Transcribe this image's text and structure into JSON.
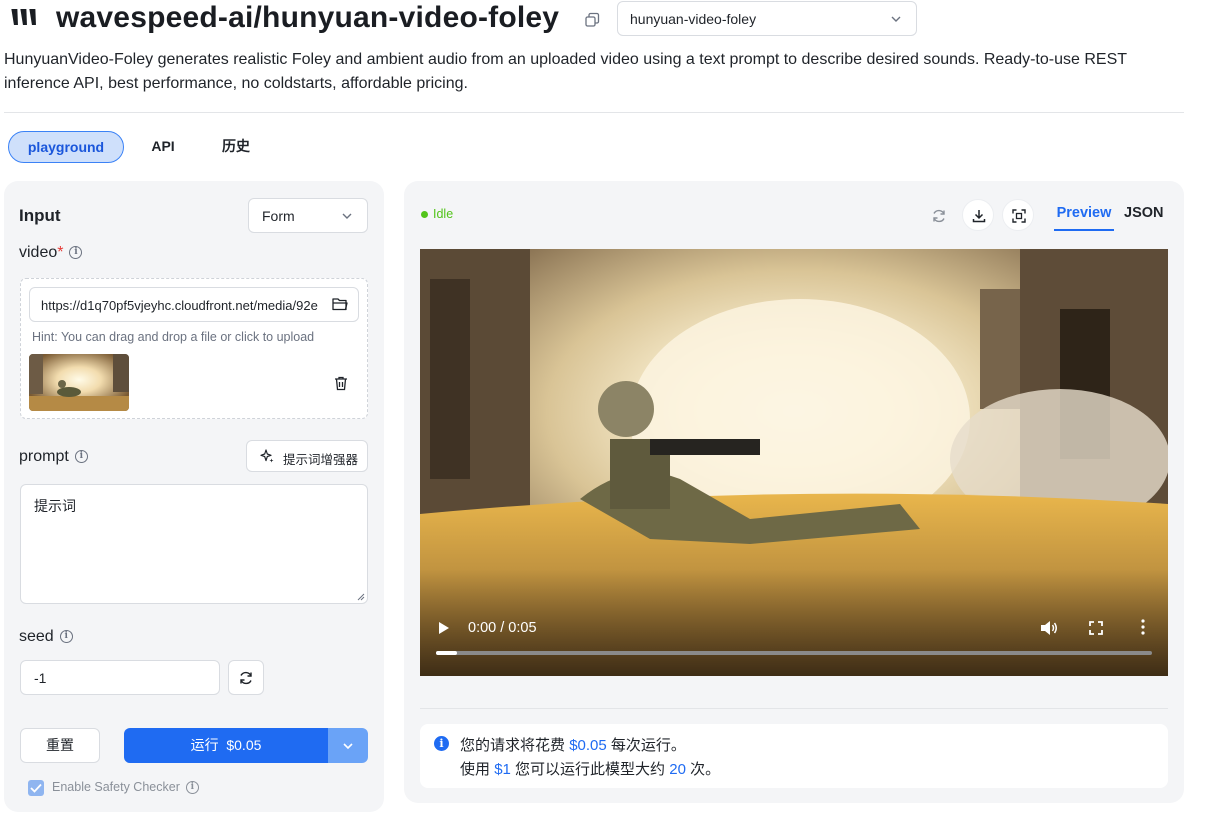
{
  "header": {
    "title": "wavespeed-ai/hunyuan-video-foley",
    "model_select_value": "hunyuan-video-foley",
    "description": "HunyuanVideo-Foley generates realistic Foley and ambient audio from an uploaded video using a text prompt to describe desired sounds. Ready-to-use REST inference API, best performance, no coldstarts, affordable pricing."
  },
  "tabs": [
    {
      "label": "playground",
      "active": true
    },
    {
      "label": "API",
      "active": false
    },
    {
      "label": "历史",
      "active": false
    }
  ],
  "input_panel": {
    "title": "Input",
    "mode_select_value": "Form",
    "video": {
      "label": "video",
      "required_mark": "*",
      "url": "https://d1q70pf5vjeyhc.cloudfront.net/media/92e",
      "hint": "Hint: You can drag and drop a file or click to upload"
    },
    "prompt": {
      "label": "prompt",
      "enhancer_label": "提示词增强器",
      "placeholder": "提示词"
    },
    "seed": {
      "label": "seed",
      "value": "-1"
    },
    "reset_label": "重置",
    "run_label": "运行",
    "run_price": "$0.05",
    "safety_checker": {
      "label": "Enable Safety Checker",
      "checked": true
    }
  },
  "output_panel": {
    "status": "Idle",
    "view_tabs": [
      {
        "label": "Preview",
        "active": true
      },
      {
        "label": "JSON",
        "active": false
      }
    ],
    "player": {
      "time": "0:00 / 0:05",
      "progress": 0.03
    },
    "cost": {
      "line1_prefix": "您的请求将花费",
      "line1_price": "$0.05",
      "line1_suffix": "每次运行。",
      "line2_prefix": "使用",
      "line2_amount": "$1",
      "line2_middle": "您可以运行此模型大约",
      "line2_count": "20",
      "line2_suffix": "次。"
    }
  },
  "icons": {
    "logo": "wavespeed-logo",
    "copy": "copy-icon",
    "folder": "folder-icon",
    "trash": "trash-icon",
    "sparkle": "sparkle-icon",
    "refresh": "refresh-icon",
    "download": "download-icon",
    "fullscreen": "fullscreen-icon",
    "info": "info-icon"
  },
  "colors": {
    "accent": "#1f6bf2",
    "status_idle": "#52c41a",
    "required": "#e53935"
  }
}
